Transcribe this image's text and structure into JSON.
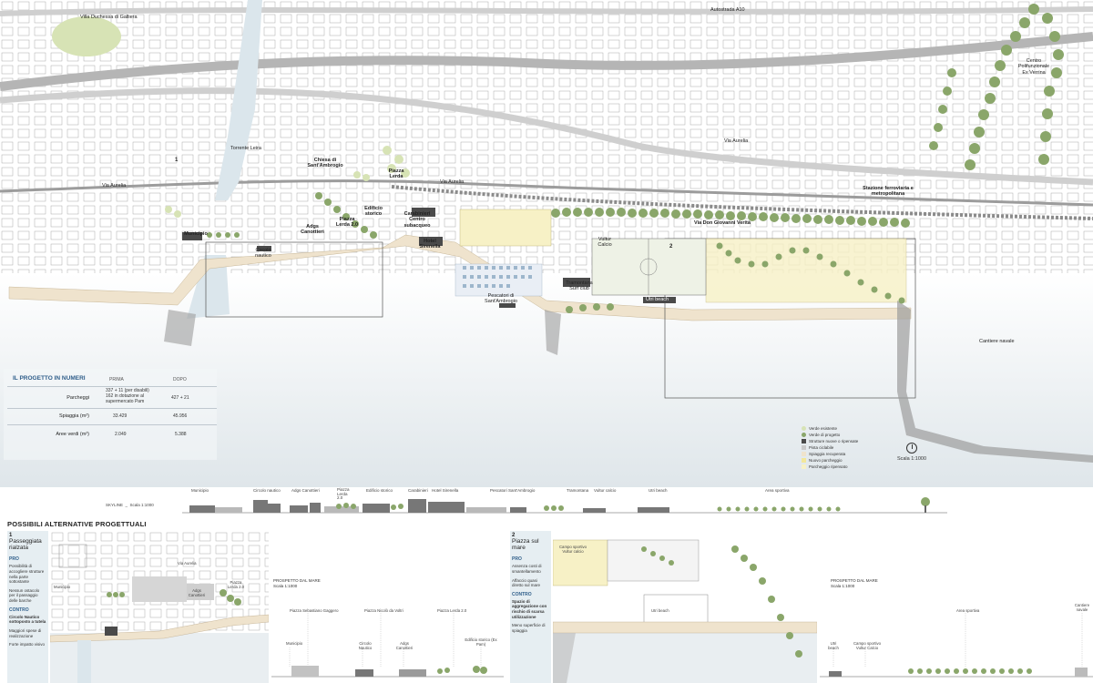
{
  "map": {
    "streets": [
      {
        "name": "street-autostrada",
        "text": "Autostrada A10"
      },
      {
        "name": "street-via-aurelia-1",
        "text": "Via Aurelia"
      },
      {
        "name": "street-via-aurelia-2",
        "text": "Via Aurelia"
      },
      {
        "name": "street-via-aurelia-3",
        "text": "Via Aurelia"
      },
      {
        "name": "street-via-don-giovanni",
        "text": "Via Don Giovanni Verità"
      }
    ],
    "places": [
      {
        "name": "place-villa-duchessa",
        "text": "Villa Duchessa di Galliera"
      },
      {
        "name": "place-torrente-leira",
        "text": "Torrente Leira"
      },
      {
        "name": "place-centro-polifunzionale",
        "text": "Centro Polifunzionale Ex Verrina"
      },
      {
        "name": "place-chiesa",
        "text": "Chiesa di Sant'Ambrogio"
      },
      {
        "name": "place-piazza-lerda-top",
        "text": "Piazza Lerda"
      },
      {
        "name": "place-stazione",
        "text": "Stazione ferroviaria e metropolitana"
      },
      {
        "name": "place-municipio",
        "text": "Municipio"
      },
      {
        "name": "place-circolo",
        "text": "Circolo nautico"
      },
      {
        "name": "place-adgs",
        "text": "Adgs Canottieri"
      },
      {
        "name": "place-piazza-lerda-20",
        "text": "Piazza Lerda 2.0"
      },
      {
        "name": "place-edificio",
        "text": "Edificio storico"
      },
      {
        "name": "place-carabinieri",
        "text": "Carabinieri Centro subacqueo"
      },
      {
        "name": "place-hotel",
        "text": "Hotel Sirenella"
      },
      {
        "name": "place-vultur",
        "text": "Vultur Calcio"
      },
      {
        "name": "place-tramontana",
        "text": "Tramontana Surf club"
      },
      {
        "name": "place-utri",
        "text": "Utri beach"
      },
      {
        "name": "place-pescatori",
        "text": "Pescatori di Sant'Ambrogio"
      },
      {
        "name": "place-cantiere",
        "text": "Cantiere navale"
      }
    ],
    "markers": [
      "1",
      "2"
    ]
  },
  "stats": {
    "title": "IL PROGETTO IN NUMERI",
    "col_before": "PRIMA",
    "col_after": "DOPO",
    "rows": [
      {
        "label": "Parcheggi",
        "before_1": "337 + 11 (per disabili)",
        "before_2": "162 in dotazione al",
        "before_3": "supermercato Pam",
        "after": "427 + 21"
      },
      {
        "label": "Spiaggia (m²)",
        "before_1": "33.429",
        "after": "45.956"
      },
      {
        "label": "Aree verdi (m²)",
        "before_1": "2.049",
        "after": "5.388"
      }
    ]
  },
  "legend": {
    "items": [
      {
        "label": "Verde esistente",
        "color": "#d7e3b5"
      },
      {
        "label": "Verde di progetto",
        "color": "#8aa66a"
      },
      {
        "label": "Strutture nuove o ripensate",
        "color": "#4a4a4a"
      },
      {
        "label": "Pista ciclabile",
        "color": "#c9c9c9"
      },
      {
        "label": "Spiaggia recuperata",
        "color": "#efe3cd"
      },
      {
        "label": "Nuovo parcheggio",
        "color": "#f2e79a"
      },
      {
        "label": "Parcheggio ripensato",
        "color": "#f7f1c6"
      }
    ],
    "scale": "Scala 1:1000"
  },
  "skyline": {
    "title": "SKYLINE",
    "scale": "Scala 1:1000",
    "labels": [
      "Municipio",
      "Circolo nautico",
      "Adgs Canottieri",
      "Piazza Lerda 2.0",
      "Edificio storico",
      "Carabinieri",
      "Hotel Sirenella",
      "Pescatori Sant'Ambrogio",
      "Tramontana",
      "Vultur calcio",
      "Utri beach",
      "Area sportiva"
    ]
  },
  "alternatives": {
    "title": "POSSIBILI ALTERNATIVE PROGETTUALI",
    "alt1": {
      "num": "1",
      "name": "Passeggiata rialzata",
      "pro_title": "PRO",
      "pro_1": "Possibilità di accogliere strutture nella parte sottostante",
      "pro_2": "Nessun ostacolo per il passaggio delle barche",
      "contro_title": "CONTRO",
      "contro_1": "Circolo Nautico sottoposto a tutela",
      "contro_2": "Maggiori spese di realizzazione",
      "contro_3": "Forte impatto visivo",
      "prosp_1": "PROSPETTO DAL MARE",
      "prosp_2": "Scala 1:1000",
      "map_labels": [
        "Via Aurelia",
        "Municipio",
        "Adgs Canottieri",
        "Piazza Lerda 2.0"
      ],
      "elev_labels": [
        "Piazza Sebastiano Gaggero",
        "Piazza Nicolò da Voltri",
        "Piazza Lerda 2.0",
        "Municipio",
        "Circolo Nautico",
        "Adgs Canottieri",
        "Edificio storico (Ex Pam)"
      ]
    },
    "alt2": {
      "num": "2",
      "name": "Piazza sul mare",
      "pro_title": "PRO",
      "pro_1": "Assenza costi di smantellamento",
      "pro_2": "Affaccio quasi diretto sul mare",
      "contro_title": "CONTRO",
      "contro_1": "Spazio di aggregazione con rischio di scarsa utilizzazione",
      "contro_2": "Meno superficie di spiaggia",
      "prosp_1": "PROSPETTO DAL MARE",
      "prosp_2": "Scala 1:1000",
      "map_labels": [
        "Campo sportivo Vultur calcio",
        "Utri beach"
      ],
      "elev_labels": [
        "Area sportiva",
        "Cantiere navale",
        "Utri beach",
        "Campo sportivo Vultur Calcio"
      ]
    }
  }
}
